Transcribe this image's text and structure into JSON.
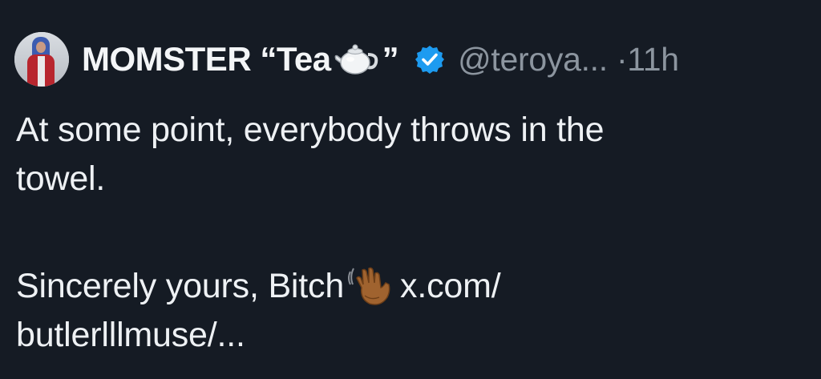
{
  "tweet": {
    "display_name": "MOMSTER “Tea",
    "display_name_suffix": "”",
    "handle": "@teroya...",
    "separator": "·",
    "time": "11h",
    "body_line1": "At some point, everybody throws in the",
    "body_line2": "towel.",
    "body_line3_text": "Sincerely yours, Bitch",
    "link_part1": "x.com/",
    "link_part2": "butlerlllmuse/..."
  },
  "icons": {
    "teapot": "teapot-emoji-icon",
    "verified": "verified-badge-icon",
    "wave": "waving-hand-emoji-icon"
  },
  "colors": {
    "background": "#151b24",
    "text": "#eef1f4",
    "muted": "#8c959f",
    "verified_blue": "#1d9bf0"
  }
}
